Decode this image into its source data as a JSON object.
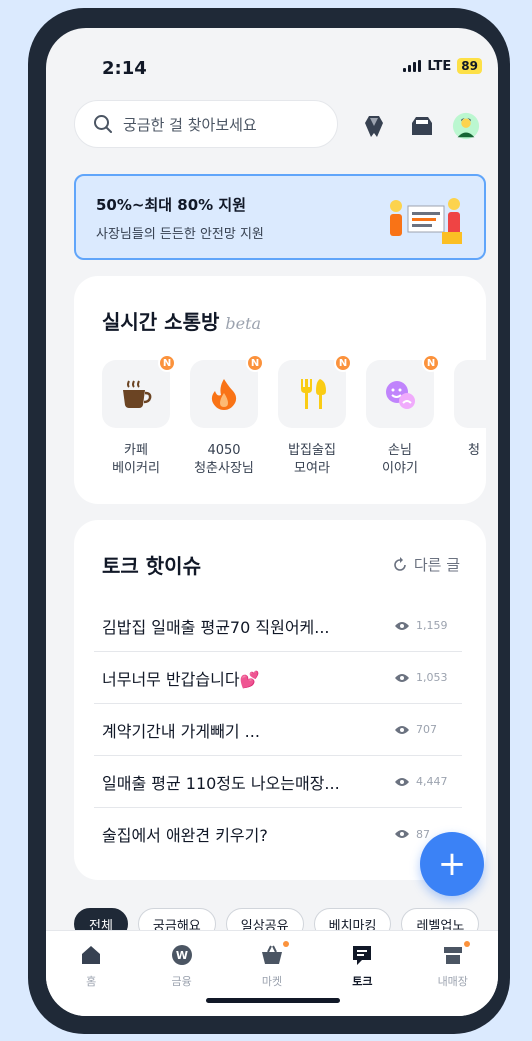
{
  "status": {
    "time": "2:14",
    "network": "LTE",
    "battery": "89"
  },
  "search": {
    "placeholder": "궁금한 걸 찾아보세요"
  },
  "banner": {
    "title": "50%~최대 80% 지원",
    "subtitle": "사장님들의 든든한 안전망 지원"
  },
  "rooms": {
    "title": "실시간 소통방",
    "beta": "beta",
    "items": [
      {
        "label": "카페\n베이커리",
        "badge": "N",
        "icon": "coffee-icon"
      },
      {
        "label": "4050\n청춘사장님",
        "badge": "N",
        "icon": "fire-icon"
      },
      {
        "label": "밥집술집\n모여라",
        "badge": "N",
        "icon": "utensils-icon"
      },
      {
        "label": "손님\n이야기",
        "badge": "N",
        "icon": "face-icon"
      },
      {
        "label": "청",
        "badge": "",
        "icon": ""
      }
    ]
  },
  "issues": {
    "title": "토크 핫이슈",
    "refresh_label": "다른 글",
    "items": [
      {
        "title": "김밥집 일매출 평균70 직원어케...",
        "views": "1,159"
      },
      {
        "title": "너무너무 반갑습니다💕",
        "views": "1,053"
      },
      {
        "title": "계약기간내 가게빼기 ...",
        "views": "707"
      },
      {
        "title": "일매출 평균 110정도 나오는매장...",
        "views": "4,447"
      },
      {
        "title": "술집에서 애완견 키우기?",
        "views": "87"
      }
    ]
  },
  "fab": {
    "label": "+"
  },
  "chips": [
    "전체",
    "궁금해요",
    "일상공유",
    "베치마킹",
    "레벨업노"
  ],
  "tabs": [
    {
      "label": "홈",
      "icon": "home-icon",
      "active": false
    },
    {
      "label": "금융",
      "icon": "won-icon",
      "active": false
    },
    {
      "label": "마켓",
      "icon": "basket-icon",
      "active": false
    },
    {
      "label": "토크",
      "icon": "chat-icon",
      "active": true
    },
    {
      "label": "내매장",
      "icon": "store-icon",
      "active": false
    }
  ],
  "colors": {
    "accent": "#3b82f6",
    "badge": "#fb923c",
    "banner_bg": "#dbeafe",
    "frame": "#1f2937"
  }
}
